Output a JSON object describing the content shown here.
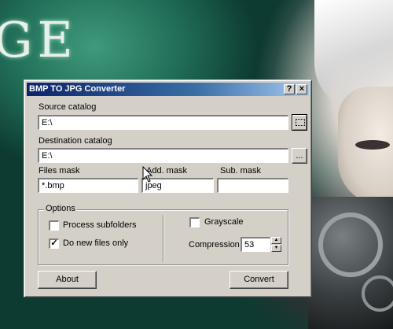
{
  "wallpaper": {
    "text": "GE",
    "colors": {
      "teal": "#1f6a55",
      "dark": "#061a16"
    }
  },
  "window": {
    "title": "BMP TO JPG Converter",
    "help_button": "?",
    "close_button": "×",
    "source": {
      "label": "Source catalog",
      "value": "E:\\"
    },
    "destination": {
      "label": "Destination catalog",
      "value": "E:\\"
    },
    "browse_button": "...",
    "files_mask": {
      "label": "Files mask",
      "value": "*.bmp"
    },
    "add_mask": {
      "label": "Add. mask",
      "value": "jpeg"
    },
    "sub_mask": {
      "label": "Sub. mask",
      "value": ""
    },
    "options": {
      "title": "Options",
      "process_subfolders": {
        "label": "Process subfolders",
        "checked": false
      },
      "new_files_only": {
        "label": "Do new files only",
        "checked": true
      },
      "grayscale": {
        "label": "Grayscale",
        "checked": false
      },
      "compression": {
        "label": "Compression",
        "value": "53"
      }
    },
    "about_button": "About",
    "convert_button": "Convert",
    "check_mark": "✓",
    "spin_up": "▲",
    "spin_down": "▼"
  }
}
